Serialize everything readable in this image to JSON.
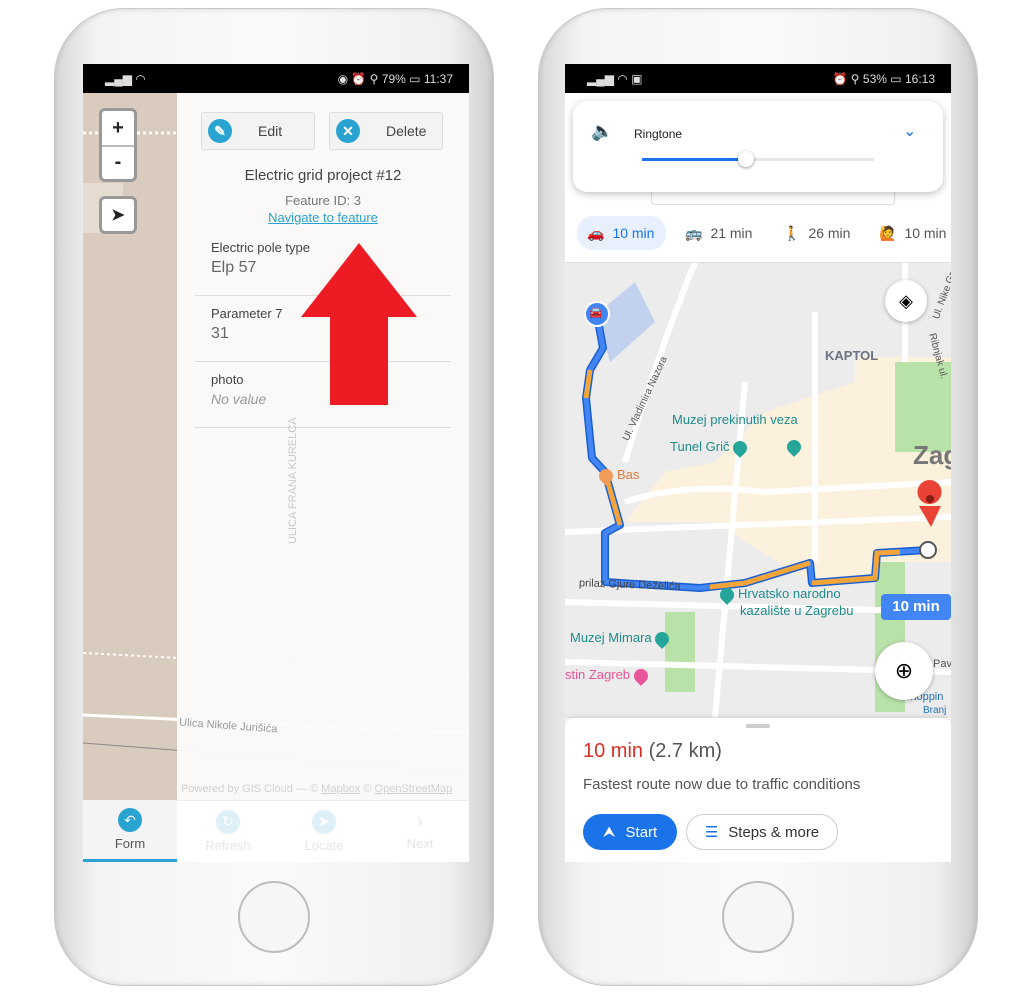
{
  "left": {
    "status": {
      "battery": "79%",
      "time": "11:37"
    },
    "map": {
      "zoom_in": "+",
      "zoom_out": "-",
      "street1": "ULICA FRANA KURELCA",
      "street2": "Ulica Nikole Jurišića",
      "attribution_prefix": "Powered by GIS Cloud — ©",
      "attr_mapbox": "Mapbox",
      "attr_osm": "OpenStreetMap"
    },
    "panel": {
      "edit_label": "Edit",
      "delete_label": "Delete",
      "title": "Electric grid project #12",
      "feature_id": "Feature ID: 3",
      "navigate_link": "Navigate to feature",
      "fields": [
        {
          "label": "Electric pole type",
          "value": "Elp 57"
        },
        {
          "label": "Parameter 7",
          "value": "31"
        },
        {
          "label": "photo",
          "value": "No value"
        }
      ]
    },
    "bottom_nav": [
      {
        "label": "Form",
        "icon": "undo-icon"
      },
      {
        "label": "Refresh",
        "icon": "refresh-icon"
      },
      {
        "label": "Locate",
        "icon": "locate-icon"
      },
      {
        "label": "Next",
        "icon": "chevron-right-icon"
      }
    ],
    "arrow_color": "#ed1c24",
    "accent": "#29a3cf"
  },
  "right": {
    "status": {
      "battery": "53%",
      "time": "16:13"
    },
    "volume": {
      "label": "Ringtone",
      "level": 0.45
    },
    "modes": [
      {
        "icon": "car-icon",
        "label": "10 min",
        "selected": true
      },
      {
        "icon": "bus-icon",
        "label": "21 min"
      },
      {
        "icon": "walk-icon",
        "label": "26 min"
      },
      {
        "icon": "ride-icon",
        "label": "10 min"
      }
    ],
    "map_labels": {
      "kaptol": "KAPTOL",
      "nazora": "Ul. Vladimira Nazora",
      "muzej_veza": "Muzej prekinutih veza",
      "tunel": "Tunel Grič",
      "bas": "Bas",
      "zagreb": "Zag",
      "prilaz": "prilaz Gjure Deželića",
      "hnk1": "Hrvatsko narodno",
      "hnk2": "kazalište u Zagrebu",
      "mimara": "Muzej Mimara",
      "hostel": "stin Zagreb",
      "ribnjak": "Ribnjak ul.",
      "nike": "Ul. Nike Gr",
      "pav": "Pav",
      "shopping": "Shoppin",
      "branj": "Branj",
      "route_time": "10 min"
    },
    "sheet": {
      "time": "10 min",
      "distance": "(2.7 km)",
      "note": "Fastest route now due to traffic conditions",
      "start_label": "Start",
      "steps_label": "Steps & more"
    },
    "colors": {
      "route": "#4285f4",
      "traffic": "#f4a53a",
      "time_red": "#d93025",
      "pin": "#ea4335"
    }
  }
}
